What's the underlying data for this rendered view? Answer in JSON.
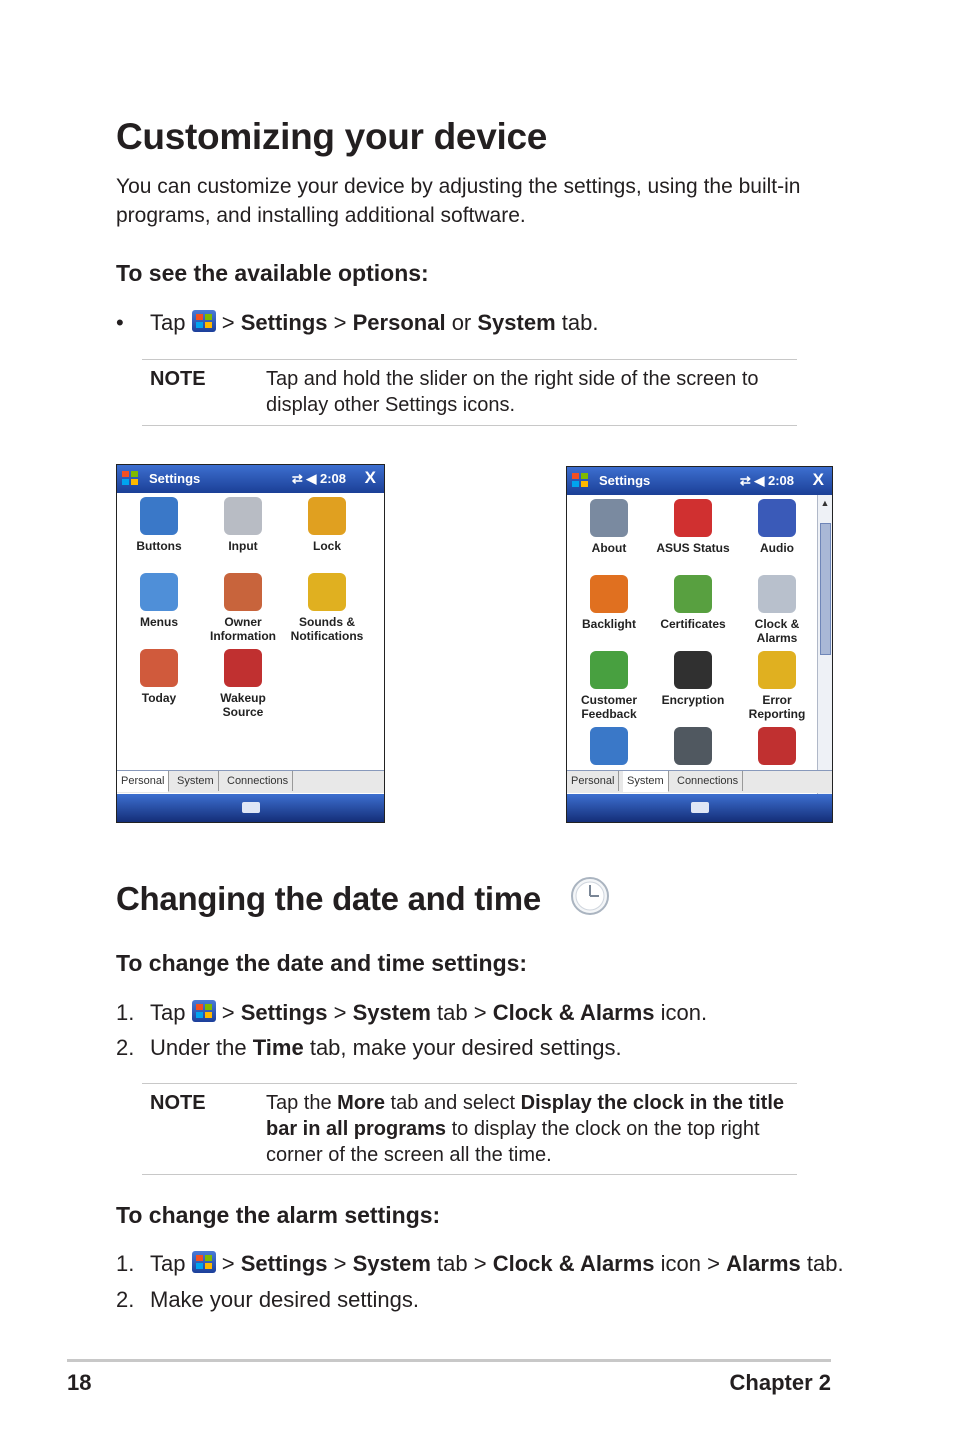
{
  "page": {
    "title": "Customizing your device",
    "intro": "You can customize your device by adjusting the settings, using the built-in programs, and installing additional software.",
    "section1": {
      "heading": "To see the available options:",
      "bullet": "•",
      "tap": "Tap",
      "gt1": ">",
      "settings": "Settings",
      "gt2": ">",
      "personal": "Personal",
      "or": "or",
      "system": "System",
      "tab": "tab."
    },
    "note1": {
      "label": "NOTE",
      "text": "Tap and hold the slider on the right side of the screen to display other Settings icons."
    },
    "section2": {
      "title": "Changing the date and time",
      "heading": "To change the date and time settings:",
      "step1": {
        "num": "1.",
        "tap": "Tap",
        "gt1": ">",
        "settings": "Settings",
        "gt2": ">",
        "system": "System",
        "tab": "tab",
        "gt3": ">",
        "clock": "Clock & Alarms",
        "icon": "icon."
      },
      "step2": {
        "num": "2.",
        "pre": "Under the",
        "time": "Time",
        "post": "tab, make your desired settings."
      }
    },
    "note2": {
      "label": "NOTE",
      "t1": "Tap the",
      "more": "More",
      "t2": "tab and select",
      "display": "Display the clock in the title bar in all programs",
      "t3": "to display the clock on the top right corner of the screen all the time."
    },
    "section3": {
      "heading": "To change the alarm settings:",
      "step1": {
        "num": "1.",
        "tap": "Tap",
        "gt1": ">",
        "settings": "Settings",
        "gt2": ">",
        "system": "System",
        "tab": "tab",
        "gt3": ">",
        "clock": "Clock & Alarms",
        "icon": "icon",
        "gt4": ">",
        "alarms": "Alarms",
        "tab2": "tab."
      },
      "step2": {
        "num": "2.",
        "text": "Make your desired settings."
      }
    },
    "footer": {
      "page_number": "18",
      "chapter": "Chapter 2"
    }
  },
  "screen_personal": {
    "title": "Settings",
    "status": "2:08",
    "close": "X",
    "icons": [
      {
        "label": "Buttons",
        "icon": "buttons-icon",
        "color": "#3a78c8"
      },
      {
        "label": "Input",
        "icon": "keyboard-icon",
        "color": "#b8bcc4"
      },
      {
        "label": "Lock",
        "icon": "key-icon",
        "color": "#e0a020"
      },
      {
        "label": "Menus",
        "icon": "menus-icon",
        "color": "#4f8fd8"
      },
      {
        "label": "Owner\nInformation",
        "icon": "owner-icon",
        "color": "#c8643c"
      },
      {
        "label": "Sounds &\nNotifications",
        "icon": "sounds-icon",
        "color": "#e0b020"
      },
      {
        "label": "Today",
        "icon": "today-icon",
        "color": "#d05a3c"
      },
      {
        "label": "Wakeup\nSource",
        "icon": "wakeup-icon",
        "color": "#c03030"
      }
    ],
    "tabs": [
      "Personal",
      "System",
      "Connections"
    ]
  },
  "screen_system": {
    "title": "Settings",
    "status": "2:08",
    "close": "X",
    "icons": [
      {
        "label": "About",
        "icon": "about-icon",
        "color": "#7a8aa0"
      },
      {
        "label": "ASUS Status",
        "icon": "asus-status-icon",
        "color": "#d03030"
      },
      {
        "label": "Audio",
        "icon": "audio-icon",
        "color": "#3a5ab8"
      },
      {
        "label": "Backlight",
        "icon": "backlight-icon",
        "color": "#e07020"
      },
      {
        "label": "Certificates",
        "icon": "certificates-icon",
        "color": "#58a040"
      },
      {
        "label": "Clock &\nAlarms",
        "icon": "clock-icon",
        "color": "#b8c0cc"
      },
      {
        "label": "Customer\nFeedback",
        "icon": "feedback-icon",
        "color": "#48a040"
      },
      {
        "label": "Encryption",
        "icon": "encryption-icon",
        "color": "#303030"
      },
      {
        "label": "Error\nReporting",
        "icon": "error-reporting-icon",
        "color": "#e0b020"
      },
      {
        "label": "",
        "icon": "globe-icon",
        "color": "#3a78c8"
      },
      {
        "label": "",
        "icon": "memory-icon",
        "color": "#505860"
      },
      {
        "label": "",
        "icon": "remove-programs-icon",
        "color": "#c03030"
      }
    ],
    "tabs": [
      "Personal",
      "System",
      "Connections"
    ]
  }
}
